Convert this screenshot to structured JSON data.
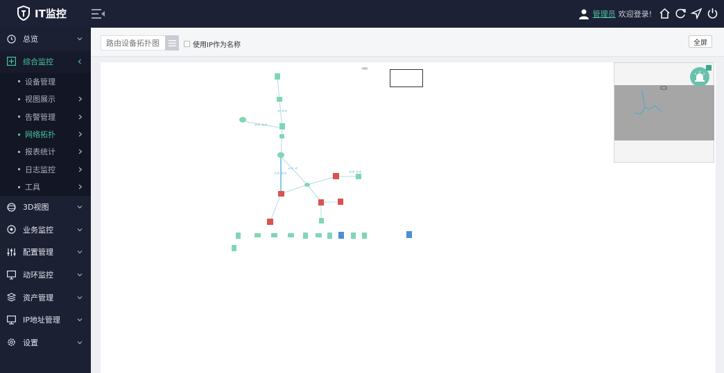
{
  "app": {
    "logo_text": "IT监控"
  },
  "header": {
    "user_name": "管理员",
    "welcome": "欢迎登录!",
    "icons": [
      "home-icon",
      "refresh-icon",
      "navigate-icon",
      "power-icon"
    ]
  },
  "sidebar": {
    "items": [
      {
        "label": "总览",
        "icon": "clock-icon"
      },
      {
        "label": "综合监控",
        "icon": "monitor-plus-icon",
        "active": true
      },
      {
        "label": "3D视图",
        "icon": "3d-icon"
      },
      {
        "label": "业务监控",
        "icon": "business-icon"
      },
      {
        "label": "配置管理",
        "icon": "sliders-icon"
      },
      {
        "label": "动环监控",
        "icon": "screen-icon"
      },
      {
        "label": "资产管理",
        "icon": "layers-icon"
      },
      {
        "label": "IP地址管理",
        "icon": "ip-icon"
      },
      {
        "label": "设置",
        "icon": "gear-icon"
      }
    ],
    "submenu": [
      {
        "label": "设备管理"
      },
      {
        "label": "视图展示"
      },
      {
        "label": "告警管理"
      },
      {
        "label": "网络拓扑",
        "active": true
      },
      {
        "label": "报表统计"
      },
      {
        "label": "日志监控"
      },
      {
        "label": "工具"
      }
    ]
  },
  "toolbar": {
    "search_placeholder": "路由设备拓扑图",
    "checkbox_label": "使用IP作为名称",
    "fullscreen_label": "全屏"
  },
  "colors": {
    "topbar_bg": "#1d2136",
    "sidebar_bg": "#1c2033",
    "accent": "#45c4a0",
    "alarm_red": "#d9534f",
    "node_green": "#7fd6b4",
    "link_blue": "#3aa7d8"
  }
}
